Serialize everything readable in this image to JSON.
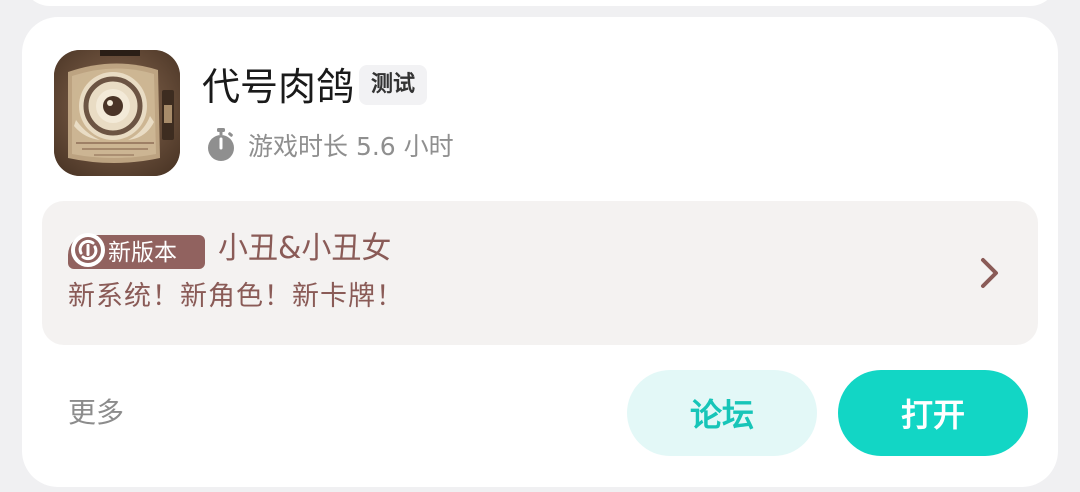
{
  "app": {
    "name": "代号肉鸽",
    "tag": "测试",
    "playtime_text": "游戏时长 5.6 小时",
    "icon": "app-icon-book-eye"
  },
  "update": {
    "badge_label": "新版本",
    "title": "小丑&小丑女",
    "subtitle": "新系统！新角色！新卡牌！"
  },
  "actions": {
    "more_label": "更多",
    "forum_label": "论坛",
    "open_label": "打开"
  },
  "colors": {
    "accent": "#12d6c5",
    "accent_light": "#e3f8f7",
    "update_text": "#8a5b57",
    "badge_bg": "#91625f"
  }
}
